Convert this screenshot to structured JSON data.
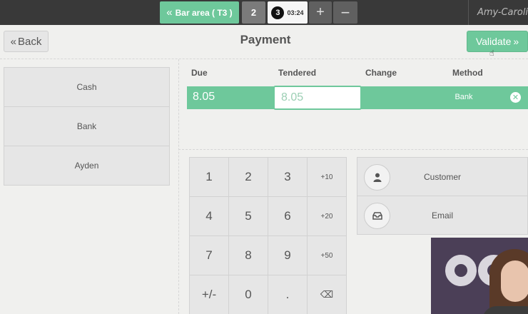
{
  "topbar": {
    "bar_area_label": "Bar area ( T3 )",
    "orders": [
      {
        "label": "2"
      },
      {
        "number": "3",
        "time": "03:24"
      }
    ],
    "add_label": "+",
    "remove_label": "−",
    "user_name": "Amy-Caroline"
  },
  "header": {
    "back_label": "Back",
    "title": "Payment",
    "validate_label": "Validate"
  },
  "methods": [
    "Cash",
    "Bank",
    "Ayden"
  ],
  "lines": {
    "columns": {
      "due": "Due",
      "tendered": "Tendered",
      "change": "Change",
      "method": "Method"
    },
    "rows": [
      {
        "due": "8.05",
        "tendered": "8.05",
        "change": "",
        "method": "Bank"
      }
    ]
  },
  "numpad": {
    "keys": [
      "1",
      "2",
      "3",
      "+10",
      "4",
      "5",
      "6",
      "+20",
      "7",
      "8",
      "9",
      "+50",
      "+/-",
      "0",
      ".",
      "⌫"
    ]
  },
  "actions": {
    "customer_label": "Customer",
    "email_label": "Email"
  },
  "colors": {
    "accent": "#6ec89b",
    "topbar": "#393939",
    "background": "#f0f0ee"
  },
  "icons": {
    "back": "double-chevron-left-icon",
    "validate": "double-chevron-right-icon",
    "customer": "user-icon",
    "email": "inbox-icon",
    "remove_line": "close-circle-icon",
    "backspace": "backspace-icon"
  }
}
